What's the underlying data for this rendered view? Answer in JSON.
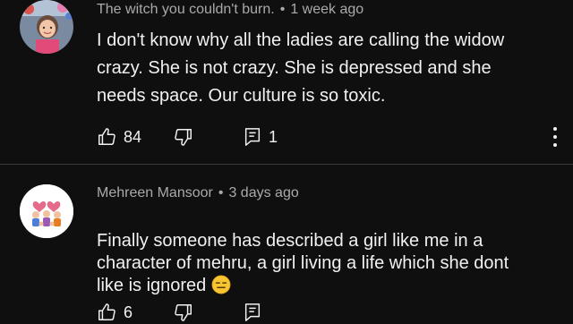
{
  "comments": [
    {
      "author": "The witch you couldn't burn.",
      "separator": "•",
      "time": "1 week ago",
      "text": "I don't know why all the ladies are calling the widow\ncrazy. She is not crazy. She is depressed and she\nneeds space. Our culture is so toxic.",
      "likes": "84",
      "replies": "1",
      "avatar": "child-photo"
    },
    {
      "author": "Mehreen Mansoor",
      "separator": "•",
      "time": "3 days ago",
      "text": "Finally someone has described a girl like me in a\ncharacter of mehru, a girl living a life which she dont\nlike is ignored",
      "emoji": "expressionless-face",
      "likes": "6",
      "avatar": "cartoon-family"
    }
  ],
  "icons": {
    "like": "thumbs-up-icon",
    "dislike": "thumbs-down-icon",
    "reply": "reply-icon",
    "menu": "more-vert-icon"
  },
  "colors": {
    "background": "#0f0f0f",
    "text": "#f1f1f1",
    "meta": "#aaaaaa",
    "divider": "#3a3a3a"
  }
}
